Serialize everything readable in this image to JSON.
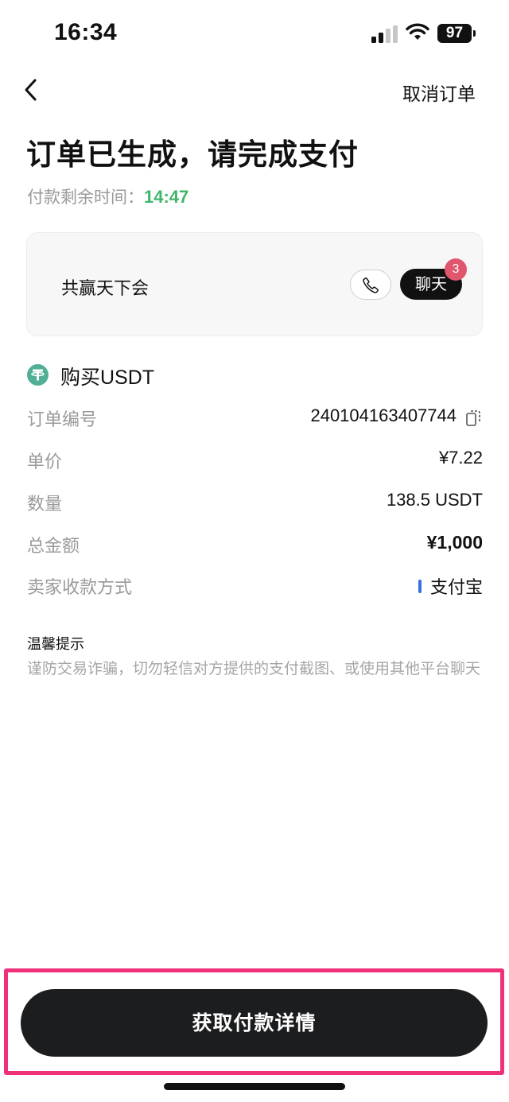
{
  "status_bar": {
    "time": "16:34",
    "battery": "97",
    "icons": [
      "signal-icon",
      "wifi-icon",
      "battery-icon"
    ]
  },
  "nav": {
    "back_icon": "chevron-left-icon",
    "cancel_label": "取消订单"
  },
  "title": "订单已生成，请完成支付",
  "timer": {
    "label": "付款剩余时间：",
    "value": "14:47",
    "color": "#3fb669"
  },
  "merchant": {
    "name": "共赢天下会",
    "phone_icon": "phone-icon",
    "chat_label": "聊天",
    "chat_badge": "3",
    "badge_color": "#e0566c"
  },
  "purchase": {
    "icon": "tether-icon",
    "title": "购买USDT",
    "rows": [
      {
        "label": "订单编号",
        "value": "240104163407744"
      },
      {
        "label": "单价",
        "value": "¥7.22"
      },
      {
        "label": "数量",
        "value": "138.5 USDT"
      },
      {
        "label": "总金额",
        "value": "¥1,000"
      },
      {
        "label": "卖家收款方式",
        "value": "支付宝",
        "mark_color": "#3b6fe0"
      }
    ]
  },
  "tips": {
    "title": "温馨提示",
    "body": "谨防交易诈骗，切勿轻信对方提供的支付截图、或使用其他平台聊天"
  },
  "primary_button": {
    "label": "获取付款详情",
    "highlight_color": "#f0317a"
  }
}
